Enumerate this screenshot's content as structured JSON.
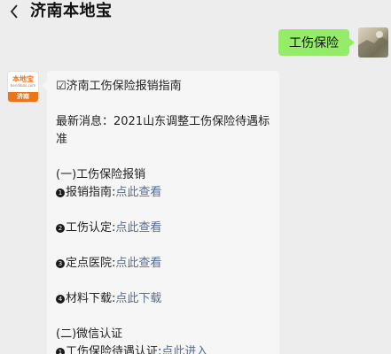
{
  "header": {
    "back_icon": "chevron-left-icon",
    "title": "济南本地宝"
  },
  "outgoing": {
    "text": "工伤保险",
    "bubble_color": "#95ec69"
  },
  "bot_avatar": {
    "brand": "本地宝",
    "site": "bendibao.com",
    "city": "济南",
    "accent": "#e8751a"
  },
  "incoming": {
    "header": "☑济南工伤保险报销指南",
    "news": "最新消息：2021山东调整工伤保险待遇标准",
    "section1": "(一)工伤保险报销",
    "items": [
      {
        "num": "1",
        "label": "报销指南:",
        "link": "点此查看"
      },
      {
        "num": "2",
        "label": "工伤认定:",
        "link": "点此查看"
      },
      {
        "num": "3",
        "label": "定点医院:",
        "link": "点此查看"
      },
      {
        "num": "4",
        "label": "材料下载:",
        "link": "点此下载"
      }
    ],
    "section2": "(二)微信认证",
    "items2": [
      {
        "num": "1",
        "label": "工伤保险待遇认证:",
        "link": "点此进入"
      }
    ],
    "link_color": "#576b95"
  }
}
